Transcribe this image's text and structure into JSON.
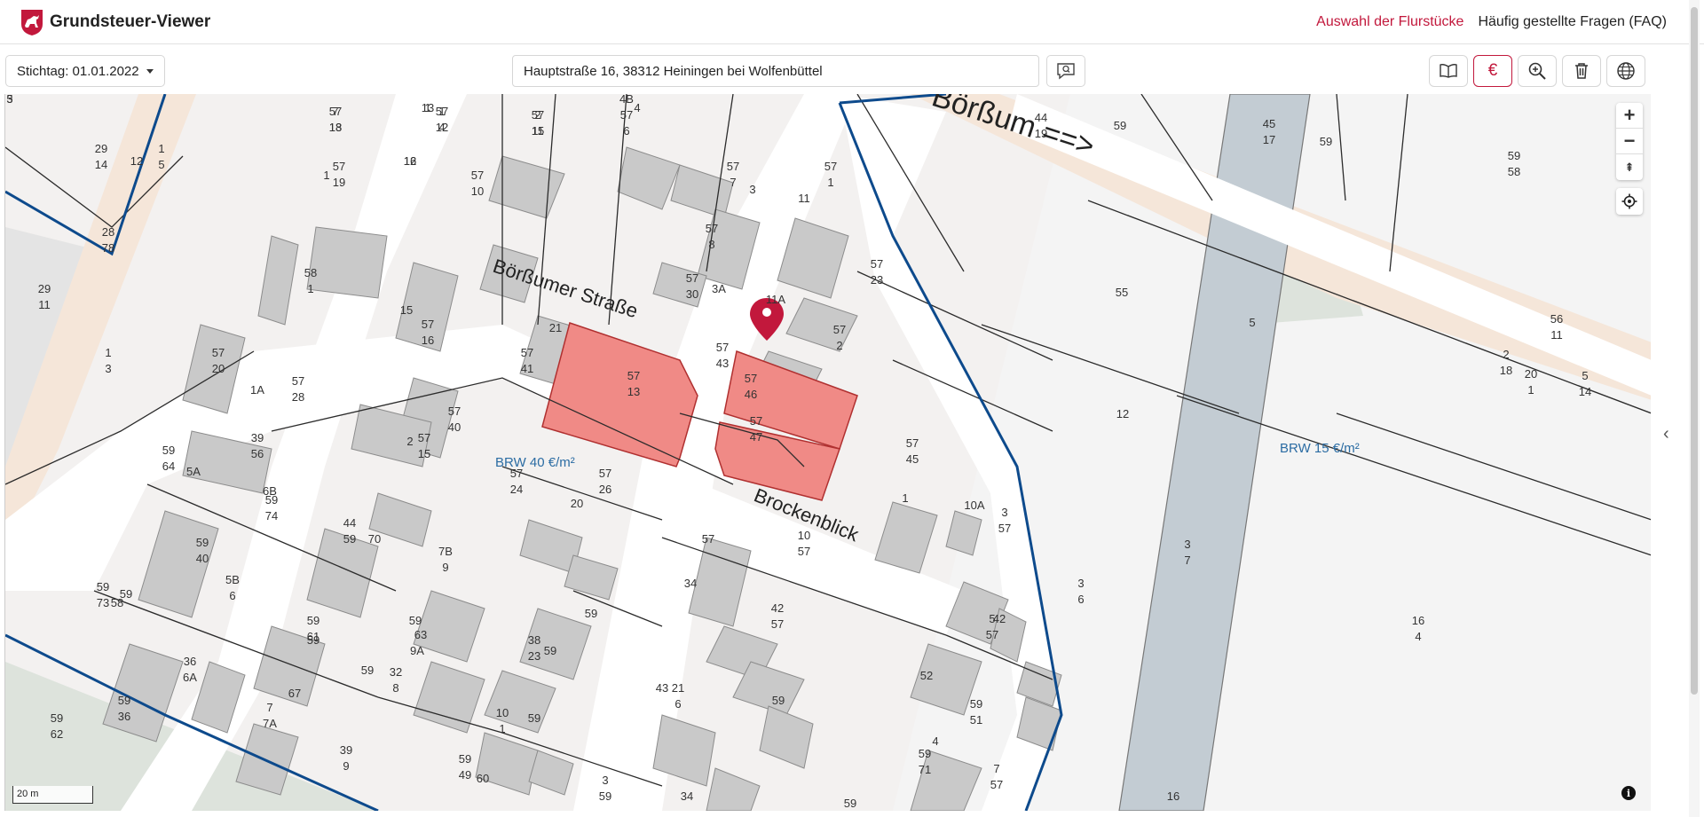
{
  "app": {
    "title": "Grundsteuer-Viewer"
  },
  "nav": {
    "items": [
      {
        "label": "Auswahl der Flurstücke",
        "active": true
      },
      {
        "label": "Häufig gestellte Fragen (FAQ)",
        "active": false
      }
    ]
  },
  "toolbar": {
    "date_label": "Stichtag: 01.01.2022",
    "address": "Hauptstraße 16, 38312 Heiningen bei Wolfenbüttel",
    "tools": [
      {
        "icon": "book-icon"
      },
      {
        "icon": "euro-icon",
        "label": "€"
      },
      {
        "icon": "zoom-in-icon"
      },
      {
        "icon": "trash-icon"
      },
      {
        "icon": "globe-icon"
      }
    ]
  },
  "map_controls": {
    "zoom_in": "+",
    "zoom_out": "−",
    "north": "⇞",
    "scale_label": "20 m",
    "info": "i",
    "side_toggle": "‹"
  },
  "colors": {
    "accent": "#c2183c",
    "parcel_selected": "#f08a86",
    "boundary_blue": "#0d4a8c",
    "road": "#ffffff",
    "building": "#c9c9c9",
    "parcel_fill": "#eeeae8",
    "water": "#c3ccd3",
    "green": "#dde3dc"
  },
  "map": {
    "streets": [
      "Börßumer Straße",
      "Brockenblick",
      "Börßum ==>"
    ],
    "brw": [
      "BRW 40 €/m²",
      "BRW 15 €/m²"
    ],
    "labels": [
      "5",
      "57",
      "18",
      "57",
      "12",
      "13",
      "12",
      "57",
      "11",
      "4B",
      "57",
      "6",
      "4",
      "57",
      "19",
      "1",
      "29",
      "14",
      "1",
      "5",
      "12",
      "57",
      "10",
      "57",
      "7",
      "3",
      "57",
      "1",
      "11",
      "28",
      "78",
      "57",
      "8",
      "57",
      "23",
      "58",
      "1",
      "57",
      "30",
      "3A",
      "11A",
      "29",
      "11",
      "15",
      "57",
      "16",
      "21",
      "57",
      "41",
      "57",
      "2",
      "1",
      "3",
      "57",
      "20",
      "1A",
      "57",
      "28",
      "57",
      "43",
      "57",
      "13",
      "57",
      "46",
      "57",
      "47",
      "57",
      "40",
      "57",
      "15",
      "2",
      "59",
      "64",
      "5A",
      "39",
      "56",
      "6B",
      "59",
      "74",
      "57",
      "24",
      "20",
      "57",
      "26",
      "57",
      "45",
      "1",
      "57",
      "10",
      "57",
      "34",
      "10A",
      "3",
      "57",
      "44",
      "59",
      "70",
      "7B",
      "9",
      "59",
      "40",
      "59",
      "58",
      "5B",
      "6",
      "59",
      "73",
      "59",
      "63",
      "9A",
      "59",
      "38",
      "23",
      "59",
      "42",
      "57",
      "42",
      "5",
      "57",
      "36",
      "6A",
      "59",
      "61",
      "59",
      "67",
      "7",
      "7A",
      "59",
      "32",
      "8",
      "59",
      "36",
      "59",
      "62",
      "10",
      "1",
      "59",
      "43",
      "21",
      "6",
      "59",
      "52",
      "59",
      "51",
      "4",
      "59",
      "71",
      "7",
      "57",
      "39",
      "9",
      "59",
      "49",
      "60",
      "3",
      "59",
      "34",
      "59",
      "44",
      "19",
      "59",
      "45",
      "17",
      "59",
      "59",
      "58",
      "55",
      "5",
      "56",
      "11",
      "12",
      "2",
      "18",
      "20",
      "1",
      "5",
      "14",
      "3",
      "7",
      "3",
      "6",
      "16",
      "4",
      "16",
      "3",
      "7",
      "13",
      "1",
      "4",
      "1",
      "16",
      "2",
      "15"
    ]
  }
}
